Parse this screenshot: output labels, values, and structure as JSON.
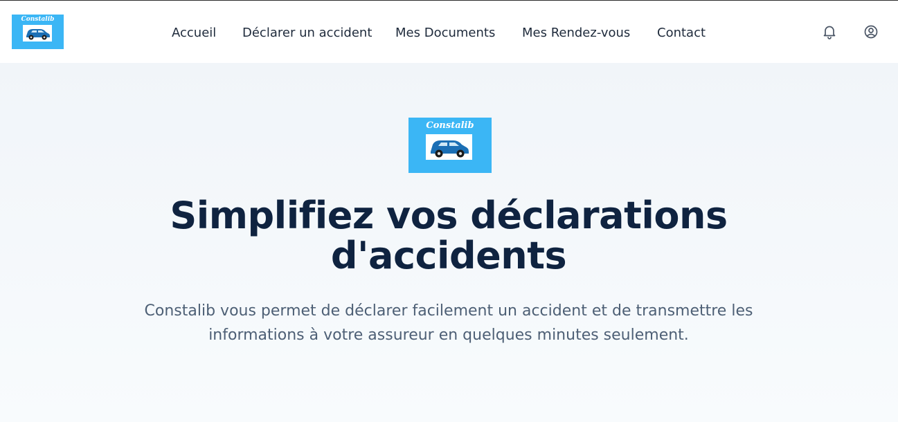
{
  "brand": {
    "name": "Constalib",
    "color": "#3bb6f5"
  },
  "nav": {
    "items": [
      {
        "label": "Accueil"
      },
      {
        "label": "Déclarer un accident"
      },
      {
        "label": "Mes Documents"
      },
      {
        "label": "Mes Rendez-vous"
      },
      {
        "label": "Contact"
      }
    ]
  },
  "header_icons": {
    "notifications": "bell-icon",
    "account": "user-circle-icon"
  },
  "hero": {
    "title": "Simplifiez vos déclarations d'accidents",
    "subtitle": "Constalib vous permet de déclarer facilement un accident et de transmettre les informations à votre assureur en quelques minutes seulement."
  }
}
